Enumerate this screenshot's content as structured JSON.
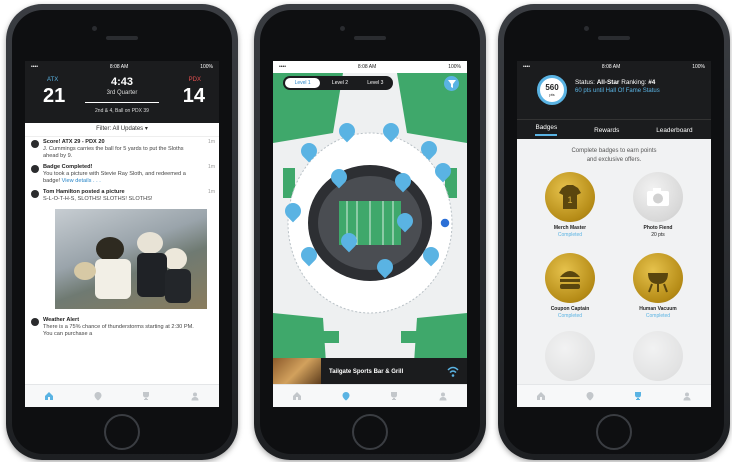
{
  "phone1": {
    "status": {
      "carrier": "•••• ",
      "time": "8:08 AM",
      "battery": "100%"
    },
    "game": {
      "home_team": "ATX",
      "home_score": "21",
      "away_team": "PDX",
      "away_score": "14",
      "clock": "4:43",
      "quarter": "3rd Quarter",
      "down_text": "2nd & 4, Ball on PDX 39"
    },
    "filter_label": "Filter: All Updates ▾",
    "feed": [
      {
        "title": "Score! ATX 29 - PDX 20",
        "body": "J. Cummings carries the ball for 5 yards to put the Sloths ahead by 9.",
        "time": "1m"
      },
      {
        "title": "Badge Completed!",
        "body": "You took a picture with Stevie Ray Sloth, and redeemed a badge!",
        "link": "View details . . .",
        "time": "1m"
      },
      {
        "title": "Tom Hamilton posted a picture",
        "body": "S-L-O-T-H-S, SLOTHS! SLOTHS! SLOTHS!",
        "time": "1m"
      },
      {
        "title": "Weather Alert",
        "body": "There is a 75% chance of thunderstorms starting at 2:30 PM. You can purchase a",
        "time": ""
      }
    ],
    "tabs": [
      "home-icon",
      "map-pin-icon",
      "trophy-icon",
      "profile-icon"
    ]
  },
  "phone2": {
    "status": {
      "carrier": "•••• ",
      "time": "8:08 AM",
      "battery": "100%"
    },
    "levels": [
      "Level 1",
      "Level 2",
      "Level 3"
    ],
    "active_level": "Level 1",
    "selected_place": "Tailgate Sports Bar & Grill",
    "tabs": [
      "home-icon",
      "map-pin-icon",
      "trophy-icon",
      "profile-icon"
    ]
  },
  "phone3": {
    "status": {
      "carrier": "•••• ",
      "time": "8:08 AM",
      "battery": "100%"
    },
    "points": "560",
    "points_unit": "pts",
    "status_label": "Status:",
    "status_value": "All-Star",
    "ranking_label": "Ranking:",
    "ranking_value": "#4",
    "hall_of_fame_text": "60 pts until Hall Of Fame Status",
    "subtabs": [
      "Badges",
      "Rewards",
      "Leaderboard"
    ],
    "intro": "Complete badges to earn points and exclusive offers.",
    "badges": [
      {
        "name": "Merch Master",
        "status": "Completed"
      },
      {
        "name": "Photo Fiend",
        "status": "20 pts"
      },
      {
        "name": "Coupon Captain",
        "status": "Completed"
      },
      {
        "name": "Human Vacuum",
        "status": "Completed"
      }
    ],
    "tabs": [
      "home-icon",
      "map-pin-icon",
      "trophy-icon",
      "profile-icon"
    ]
  },
  "colors": {
    "accent": "#5ab3e3",
    "dark": "#1b1c1e",
    "field_green": "#3fa86b"
  }
}
